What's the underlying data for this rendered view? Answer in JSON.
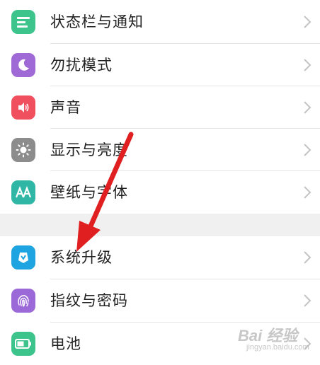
{
  "settings": {
    "items": [
      {
        "label": "状态栏与通知",
        "icon": "notification-bar-icon",
        "color": "#3dc48c"
      },
      {
        "label": "勿扰模式",
        "icon": "moon-icon",
        "color": "#a06ad6"
      },
      {
        "label": "声音",
        "icon": "speaker-icon",
        "color": "#f0505e"
      },
      {
        "label": "显示与亮度",
        "icon": "brightness-icon",
        "color": "#8c8c8c"
      },
      {
        "label": "壁纸与字体",
        "icon": "font-icon",
        "color": "#2fb6a4"
      },
      {
        "label": "系统升级",
        "icon": "system-update-icon",
        "color": "#1ea4e0"
      },
      {
        "label": "指纹与密码",
        "icon": "fingerprint-icon",
        "color": "#9b6ad8"
      },
      {
        "label": "电池",
        "icon": "battery-icon",
        "color": "#3dc48c"
      }
    ]
  },
  "annotation": {
    "arrow_color": "#e02020"
  },
  "watermark": {
    "main": "Bai 经验",
    "sub": "jingyan.baidu.com"
  }
}
